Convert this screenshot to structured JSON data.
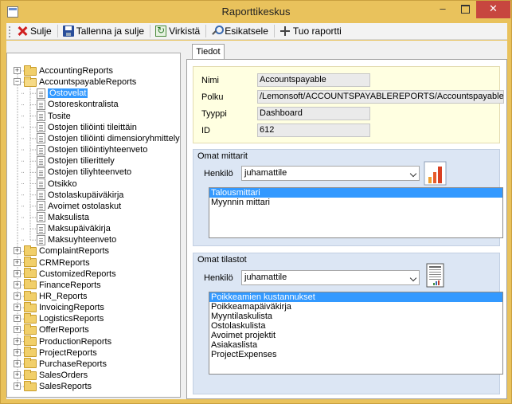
{
  "window": {
    "title": "Raporttikeskus"
  },
  "toolbar": {
    "close_label": "Sulje",
    "save_close_label": "Tallenna ja sulje",
    "refresh_label": "Virkistä",
    "preview_label": "Esikatsele",
    "import_label": "Tuo raportti"
  },
  "tree": {
    "top_before": [
      {
        "label": "AccountingReports"
      }
    ],
    "expanded": {
      "label": "AccountspayableReports",
      "children": [
        "Ostovelat",
        "Ostoreskontralista",
        "Tosite",
        "Ostojen tiliöinti tileittäin",
        "Ostojen tiliöinti dimensioryhmittely",
        "Ostojen tiliöintiyhteenveto",
        "Ostojen tilierittely",
        "Ostojen tiliyhteenveto",
        "Otsikko",
        "Ostolaskupäiväkirja",
        "Avoimet ostolaskut",
        "Maksulista",
        "Maksupäiväkirja",
        "Maksuyhteenveto"
      ],
      "selected_index": 0
    },
    "top_after": [
      "ComplaintReports",
      "CRMReports",
      "CustomizedReports",
      "FinanceReports",
      "HR_Reports",
      "InvoicingReports",
      "LogisticsReports",
      "OfferReports",
      "ProductionReports",
      "ProjectReports",
      "PurchaseReports",
      "SalesOrders",
      "SalesReports"
    ]
  },
  "tabs": [
    {
      "label": "Tiedot"
    }
  ],
  "details": {
    "name_label": "Nimi",
    "name_value": "Accountspayable",
    "path_label": "Polku",
    "path_value": "/Lemonsoft/ACCOUNTSPAYABLEREPORTS/Accountspayable.rdl",
    "type_label": "Tyyppi",
    "type_value": "Dashboard",
    "id_label": "ID",
    "id_value": "612"
  },
  "meters": {
    "title": "Omat mittarit",
    "person_label": "Henkilö",
    "person_value": "juhamattile",
    "items": [
      "Talousmittari",
      "Myynnin mittari"
    ],
    "selected_index": 0,
    "icon": "bar-chart-icon"
  },
  "stats": {
    "title": "Omat tilastot",
    "person_label": "Henkilö",
    "person_value": "juhamattile",
    "items": [
      "Poikkeamien kustannukset",
      "Poikkeamapäiväkirja",
      "Myyntilaskulista",
      "Ostolaskulista",
      "Avoimet projektit",
      "Asiakaslista",
      "ProjectExpenses"
    ],
    "selected_index": 0,
    "icon": "report-document-icon"
  }
}
